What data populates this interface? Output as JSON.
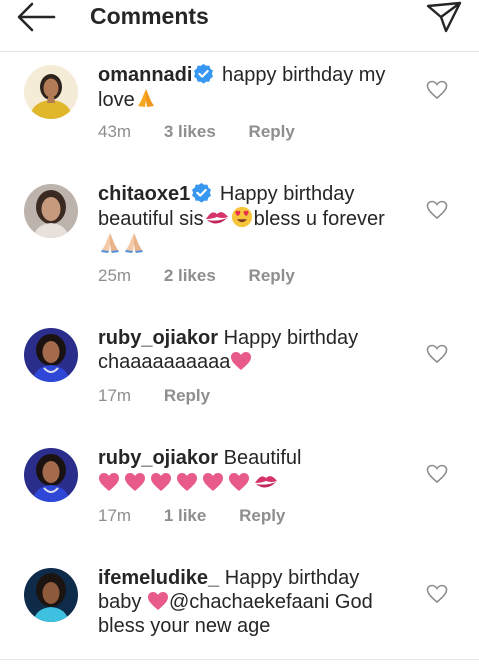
{
  "header": {
    "title": "Comments",
    "back_icon": "arrow-left-icon",
    "send_icon": "paper-plane-icon"
  },
  "colors": {
    "text": "#262626",
    "meta": "#8e8e8e",
    "verified_badge": "#3897f0",
    "heart_emoji": "#e75a8a"
  },
  "comments": [
    {
      "username": "omannadi",
      "verified": true,
      "lines": [
        "happy birthday my",
        "love"
      ],
      "emojis": [
        "folded-hands"
      ],
      "time": "43m",
      "likes": "3 likes",
      "reply": "Reply"
    },
    {
      "username": "chitaoxe1",
      "verified": true,
      "lines": [
        "Happy birthday",
        "beautiful sis",
        "bless u forever"
      ],
      "emojis": [
        "kiss-mark",
        "heart-eyes-face",
        "folded-hands",
        "folded-hands"
      ],
      "time": "25m",
      "likes": "2 likes",
      "reply": "Reply"
    },
    {
      "username": "ruby_ojiakor",
      "verified": false,
      "lines": [
        "Happy birthday",
        "chaaaaaaaaaa"
      ],
      "emojis": [
        "heavy-heart"
      ],
      "time": "17m",
      "likes": "",
      "reply": "Reply"
    },
    {
      "username": "ruby_ojiakor",
      "verified": false,
      "lines": [
        "Beautiful"
      ],
      "emojis": [
        "heavy-heart",
        "heavy-heart",
        "heavy-heart",
        "heavy-heart",
        "heavy-heart",
        "heavy-heart",
        "kiss-mark"
      ],
      "time": "17m",
      "likes": "1 like",
      "reply": "Reply"
    },
    {
      "username": "ifemeludike_",
      "verified": false,
      "lines": [
        "Happy birthday",
        "baby",
        "@chachaekefaani God",
        "bless your new age"
      ],
      "emojis": [
        "heavy-heart"
      ],
      "time": "",
      "likes": "",
      "reply": ""
    }
  ]
}
